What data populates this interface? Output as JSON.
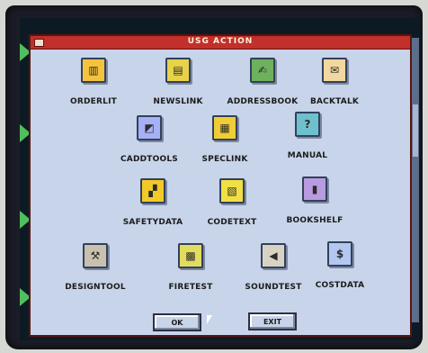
{
  "window": {
    "title": "USG ACTION"
  },
  "items": [
    {
      "label": "ORDERLIT",
      "glyph": "▥",
      "icon_color": "#f4c23d",
      "icon": "order-books-icon"
    },
    {
      "label": "NEWSLINK",
      "glyph": "▤",
      "icon_color": "#e7d24a",
      "icon": "newsletter-icon"
    },
    {
      "label": "ADDRESSBOOK",
      "glyph": "✍",
      "icon_color": "#6eb15d",
      "icon": "address-book-icon"
    },
    {
      "label": "BACKTALK",
      "glyph": "✉",
      "icon_color": "#f1d89e",
      "icon": "feedback-icon"
    },
    {
      "label": "CADDTOOLS",
      "glyph": "◩",
      "icon_color": "#a7b0f5",
      "icon": "cad-tools-icon"
    },
    {
      "label": "SPECLINK",
      "glyph": "▦",
      "icon_color": "#f0cd35",
      "icon": "spec-document-icon"
    },
    {
      "label": "MANUAL",
      "glyph": "?",
      "icon_color": "#6fc0cd",
      "icon": "manual-help-icon"
    },
    {
      "label": "SAFETYDATA",
      "glyph": "▞",
      "icon_color": "#f2c927",
      "icon": "safety-hazard-icon"
    },
    {
      "label": "CODETEXT",
      "glyph": "▧",
      "icon_color": "#f1e043",
      "icon": "code-text-icon"
    },
    {
      "label": "BOOKSHELF",
      "glyph": "▮",
      "icon_color": "#b99be0",
      "icon": "bookshelf-icon"
    },
    {
      "label": "DESIGNTOOL",
      "glyph": "⚒",
      "icon_color": "#c9c0ad",
      "icon": "hammer-icon"
    },
    {
      "label": "FIRETEST",
      "glyph": "▩",
      "icon_color": "#e2dc60",
      "icon": "fire-test-icon"
    },
    {
      "label": "SOUNDTEST",
      "glyph": "◀",
      "icon_color": "#d8d2c4",
      "icon": "speaker-icon"
    },
    {
      "label": "COSTDATA",
      "glyph": "$",
      "icon_color": "#b3c7f0",
      "icon": "dollar-icon"
    }
  ],
  "buttons": {
    "ok": "OK",
    "exit": "EXIT"
  }
}
